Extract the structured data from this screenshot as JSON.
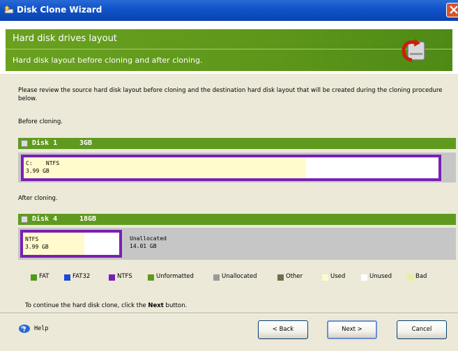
{
  "window": {
    "title": "Disk Clone Wizard"
  },
  "header": {
    "title": "Hard disk drives layout",
    "subtitle": "Hard disk layout before cloning and after cloning."
  },
  "instructions": "Please review the source hard disk layout before cloning and the destination hard disk layout that will be created during the cloning procedure below.",
  "before": {
    "label": "Before cloning.",
    "disk_name": "Disk 1",
    "disk_size": "3GB",
    "partition": {
      "drive": "C:",
      "fs": "NTFS",
      "size": "3.99 GB",
      "used_fraction": 0.68
    }
  },
  "after": {
    "label": "After cloning.",
    "disk_name": "Disk 4",
    "disk_size": "18GB",
    "partition": {
      "fs": "NTFS",
      "size": "3.99 GB",
      "used_fraction": 0.64
    },
    "unallocated": {
      "label": "Unallocated",
      "size": "14.01 GB"
    }
  },
  "legend": [
    {
      "label": "FAT",
      "color": "#4f9a1b"
    },
    {
      "label": "FAT32",
      "color": "#1e49d6"
    },
    {
      "label": "NTFS",
      "color": "#7a1fb4"
    },
    {
      "label": "Unformatted",
      "color": "#5f9a1e"
    },
    {
      "label": "Unallocated",
      "color": "#9a9a9a"
    },
    {
      "label": "Other",
      "color": "#6f6f4f"
    },
    {
      "label": "Used",
      "color": "#fffbcc"
    },
    {
      "label": "Unused",
      "color": "#ffffff"
    },
    {
      "label": "Bad",
      "color": "#e8f09a"
    }
  ],
  "continue_text": {
    "before": "To continue the hard disk clone, click the ",
    "bold": "Next",
    "after": " button."
  },
  "footer": {
    "help": "Help",
    "back": "< Back",
    "next": "Next >",
    "cancel": "Cancel"
  }
}
